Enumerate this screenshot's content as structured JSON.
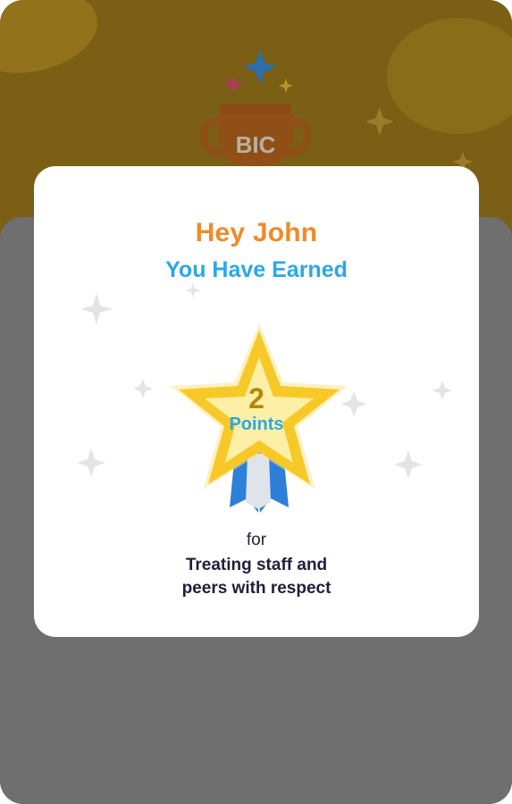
{
  "banner": {
    "trophy_label": "BIC"
  },
  "modal": {
    "greeting": "Hey John",
    "subtitle": "You Have Earned",
    "points_value": "2",
    "points_label": "Points",
    "for_text": "for",
    "reason_line1": "Treating staff and",
    "reason_line2": "peers with respect"
  },
  "colors": {
    "greeting": "#f08a2a",
    "subtitle": "#2aa8e6",
    "banner_gold": "#7a5f14",
    "overlay_gray": "#6f6f6f",
    "star_gold": "#f7c928"
  },
  "icons": [
    "sparkle-icon",
    "trophy-icon",
    "star-medal-icon",
    "ribbon-icon"
  ]
}
